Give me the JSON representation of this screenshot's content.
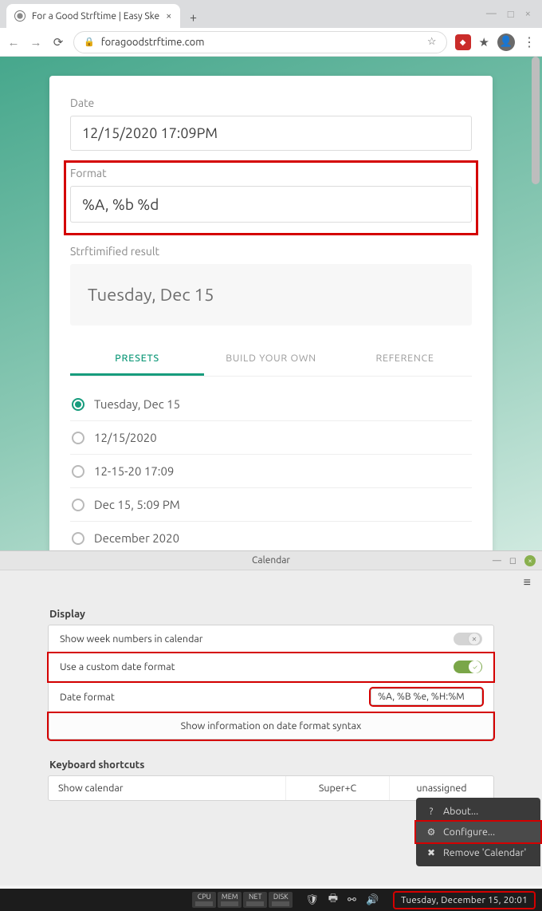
{
  "browser": {
    "tab_title": "For a Good Strftime | Easy Ske",
    "url": "foragoodstrftime.com"
  },
  "strftime": {
    "labels": {
      "date": "Date",
      "format": "Format",
      "result": "Strftimified result"
    },
    "date_value": "12/15/2020 17:09PM",
    "format_value": "%A, %b %d",
    "result_value": "Tuesday, Dec 15",
    "tabs": {
      "presets": "PRESETS",
      "build": "BUILD YOUR OWN",
      "reference": "REFERENCE"
    },
    "presets": [
      "Tuesday, Dec 15",
      "12/15/2020",
      "12-15-20 17:09",
      "Dec 15, 5:09 PM",
      "December 2020"
    ]
  },
  "calendar": {
    "window_title": "Calendar",
    "display_section": "Display",
    "rows": {
      "weeknums": "Show week numbers in calendar",
      "customfmt": "Use a custom date format",
      "datefmt_label": "Date format",
      "datefmt_value": "%A, %B %e, %H:%M",
      "info_btn": "Show information on date format syntax"
    },
    "kb_section": "Keyboard shortcuts",
    "kb": {
      "label": "Show calendar",
      "key1": "Super+C",
      "key2": "unassigned"
    }
  },
  "ctxmenu": {
    "about": "About...",
    "configure": "Configure...",
    "remove": "Remove 'Calendar'"
  },
  "taskbar": {
    "mons": [
      "CPU",
      "MEM",
      "NET",
      "DISK"
    ],
    "clock": "Tuesday, December 15, 20:01"
  }
}
